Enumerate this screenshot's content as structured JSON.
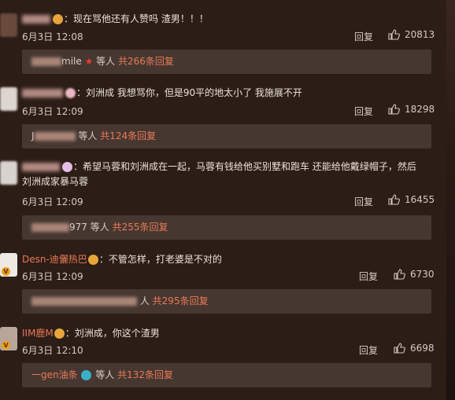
{
  "comments": [
    {
      "text": "：现在骂他还有人赞吗 渣男！！！",
      "date": "6月3日 12:08",
      "reply_label": "回复",
      "likes": "20813",
      "sub": {
        "name_suffix": "mile",
        "people": "等人",
        "total": "共266条回复"
      }
    },
    {
      "text": "：刘洲成 我想骂你，但是90平的地太小了 我施展不开",
      "date": "6月3日 12:09",
      "reply_label": "回复",
      "likes": "18298",
      "sub": {
        "name_suffix": "J",
        "people": "等人",
        "total": "共124条回复"
      }
    },
    {
      "text": "：希望马蓉和刘洲成在一起，马蓉有钱给他买别墅和跑车 还能给他戴绿帽子，然后",
      "text2": "刘洲成家暴马蓉",
      "date": "6月3日 12:09",
      "reply_label": "回复",
      "likes": "16455",
      "sub": {
        "name_suffix": "977",
        "people": "等人",
        "total": "共255条回复"
      }
    },
    {
      "username": "Desn-迪儷热巴",
      "text": "：不管怎样，打老婆是不对的",
      "date": "6月3日 12:09",
      "reply_label": "回复",
      "likes": "6730",
      "sub": {
        "name_suffix": "人",
        "total": "共295条回复"
      }
    },
    {
      "username": "IIM鹿M",
      "text": "：刘洲成，你这个渣男",
      "date": "6月3日 12:10",
      "reply_label": "回复",
      "likes": "6698",
      "sub": {
        "name_prefix": "一gen油条",
        "people": "等人",
        "total": "共132条回复"
      }
    }
  ],
  "colors": {
    "background": "#2c1d17",
    "accent": "#e97a57",
    "subbox": "#473731"
  }
}
